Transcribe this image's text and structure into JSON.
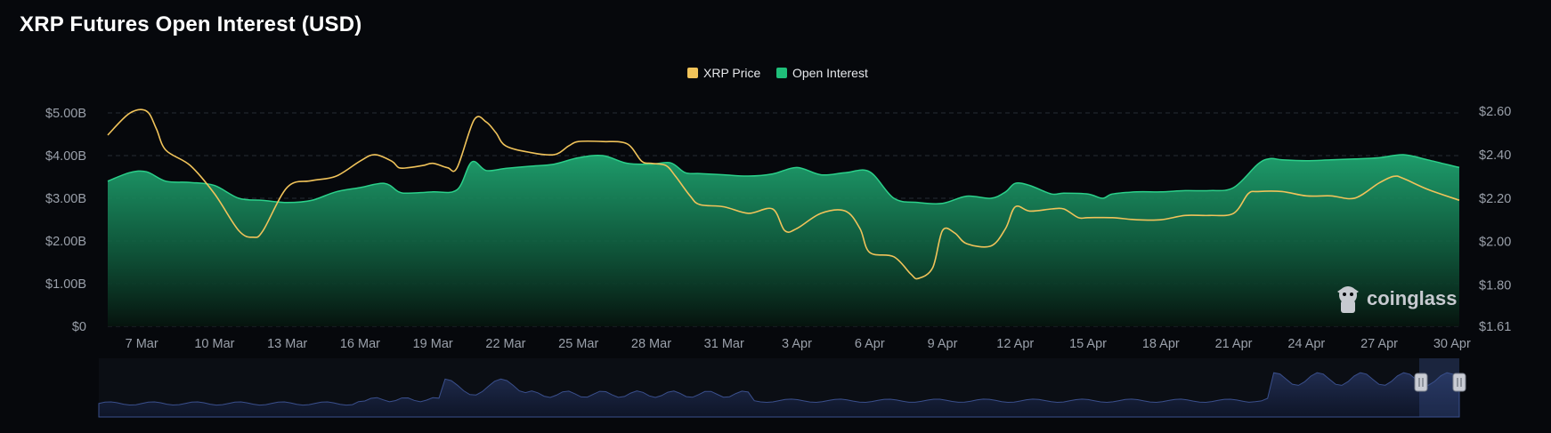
{
  "title": "XRP Futures Open Interest (USD)",
  "watermark": "coinglass",
  "legend": [
    {
      "label": "XRP Price",
      "color": "#f0c35a"
    },
    {
      "label": "Open Interest",
      "color": "#1fbf7a"
    }
  ],
  "chart_data": {
    "type": "area",
    "title": "XRP Futures Open Interest (USD)",
    "legend_position": "top-center",
    "x_tick_labels": [
      "7 Mar",
      "10 Mar",
      "13 Mar",
      "16 Mar",
      "19 Mar",
      "22 Mar",
      "25 Mar",
      "28 Mar",
      "31 Mar",
      "3 Apr",
      "6 Apr",
      "9 Apr",
      "12 Apr",
      "15 Apr",
      "18 Apr",
      "21 Apr",
      "24 Apr",
      "27 Apr",
      "30 Apr"
    ],
    "y_left": {
      "tick_labels": [
        "$0",
        "$1.00B",
        "$2.00B",
        "$3.00B",
        "$4.00B",
        "$5.00B"
      ],
      "ticks": [
        0,
        1,
        2,
        3,
        4,
        5
      ],
      "range": [
        0,
        5.5
      ],
      "unit": "billion USD"
    },
    "y_right": {
      "tick_labels": [
        "$1.61",
        "$1.80",
        "$2.00",
        "$2.20",
        "$2.40",
        "$2.60"
      ],
      "ticks": [
        1.61,
        1.8,
        2.0,
        2.2,
        2.4,
        2.6
      ],
      "range": [
        1.61,
        2.69
      ]
    },
    "grid": true,
    "x_range": [
      5.6,
      61.3
    ],
    "series": [
      {
        "name": "Open Interest",
        "axis": "left",
        "color": "#1fbf7a",
        "points": [
          [
            5.6,
            3.4
          ],
          [
            6.5,
            3.6
          ],
          [
            7.2,
            3.62
          ],
          [
            8,
            3.4
          ],
          [
            9,
            3.37
          ],
          [
            10,
            3.3
          ],
          [
            11,
            3.0
          ],
          [
            12,
            2.95
          ],
          [
            13,
            2.9
          ],
          [
            14,
            2.95
          ],
          [
            15,
            3.15
          ],
          [
            16,
            3.25
          ],
          [
            17,
            3.35
          ],
          [
            17.6,
            3.15
          ],
          [
            18,
            3.12
          ],
          [
            19,
            3.15
          ],
          [
            20,
            3.2
          ],
          [
            20.6,
            3.85
          ],
          [
            21.2,
            3.65
          ],
          [
            22,
            3.7
          ],
          [
            23,
            3.75
          ],
          [
            24,
            3.8
          ],
          [
            25,
            3.95
          ],
          [
            26,
            4.0
          ],
          [
            27,
            3.82
          ],
          [
            28,
            3.8
          ],
          [
            28.8,
            3.83
          ],
          [
            29.4,
            3.6
          ],
          [
            30,
            3.58
          ],
          [
            31,
            3.55
          ],
          [
            32,
            3.52
          ],
          [
            33,
            3.57
          ],
          [
            34,
            3.72
          ],
          [
            35,
            3.55
          ],
          [
            36,
            3.6
          ],
          [
            37,
            3.62
          ],
          [
            38,
            3.0
          ],
          [
            39,
            2.9
          ],
          [
            40,
            2.88
          ],
          [
            41,
            3.05
          ],
          [
            42,
            3.0
          ],
          [
            42.6,
            3.15
          ],
          [
            43,
            3.35
          ],
          [
            43.6,
            3.3
          ],
          [
            44.5,
            3.1
          ],
          [
            45,
            3.12
          ],
          [
            46,
            3.1
          ],
          [
            46.6,
            3.0
          ],
          [
            47,
            3.1
          ],
          [
            48,
            3.15
          ],
          [
            49,
            3.15
          ],
          [
            50,
            3.18
          ],
          [
            51,
            3.18
          ],
          [
            52,
            3.25
          ],
          [
            53,
            3.8
          ],
          [
            53.5,
            3.93
          ],
          [
            54,
            3.9
          ],
          [
            55,
            3.88
          ],
          [
            56,
            3.9
          ],
          [
            57,
            3.92
          ],
          [
            58,
            3.95
          ],
          [
            59,
            4.02
          ],
          [
            60,
            3.9
          ],
          [
            61.3,
            3.72
          ]
        ]
      },
      {
        "name": "XRP Price",
        "axis": "right",
        "color": "#f0c35a",
        "points": [
          [
            5.6,
            2.49
          ],
          [
            6.5,
            2.59
          ],
          [
            7.2,
            2.6
          ],
          [
            7.6,
            2.52
          ],
          [
            8,
            2.42
          ],
          [
            9,
            2.35
          ],
          [
            10,
            2.22
          ],
          [
            11,
            2.05
          ],
          [
            11.6,
            2.02
          ],
          [
            12,
            2.05
          ],
          [
            13,
            2.25
          ],
          [
            14,
            2.28
          ],
          [
            15,
            2.3
          ],
          [
            16,
            2.37
          ],
          [
            16.6,
            2.4
          ],
          [
            17.3,
            2.37
          ],
          [
            17.6,
            2.34
          ],
          [
            18,
            2.34
          ],
          [
            18.6,
            2.35
          ],
          [
            19,
            2.36
          ],
          [
            19.6,
            2.34
          ],
          [
            20,
            2.34
          ],
          [
            20.7,
            2.56
          ],
          [
            21.2,
            2.55
          ],
          [
            21.6,
            2.5
          ],
          [
            22,
            2.44
          ],
          [
            23,
            2.41
          ],
          [
            24,
            2.4
          ],
          [
            24.6,
            2.44
          ],
          [
            25,
            2.46
          ],
          [
            26,
            2.46
          ],
          [
            27,
            2.45
          ],
          [
            27.6,
            2.37
          ],
          [
            28,
            2.36
          ],
          [
            28.6,
            2.35
          ],
          [
            29,
            2.3
          ],
          [
            29.6,
            2.21
          ],
          [
            30,
            2.17
          ],
          [
            31,
            2.16
          ],
          [
            32,
            2.13
          ],
          [
            33,
            2.15
          ],
          [
            33.5,
            2.05
          ],
          [
            34,
            2.06
          ],
          [
            35,
            2.13
          ],
          [
            36,
            2.14
          ],
          [
            36.6,
            2.06
          ],
          [
            37,
            1.95
          ],
          [
            38,
            1.93
          ],
          [
            38.7,
            1.85
          ],
          [
            39,
            1.83
          ],
          [
            39.6,
            1.88
          ],
          [
            40,
            2.05
          ],
          [
            40.5,
            2.04
          ],
          [
            41,
            1.99
          ],
          [
            42,
            1.98
          ],
          [
            42.6,
            2.06
          ],
          [
            43,
            2.16
          ],
          [
            43.6,
            2.14
          ],
          [
            44.5,
            2.15
          ],
          [
            45,
            2.15
          ],
          [
            45.6,
            2.11
          ],
          [
            46,
            2.11
          ],
          [
            47,
            2.11
          ],
          [
            48,
            2.1
          ],
          [
            49,
            2.1
          ],
          [
            50,
            2.12
          ],
          [
            51,
            2.12
          ],
          [
            52,
            2.13
          ],
          [
            52.6,
            2.22
          ],
          [
            53,
            2.23
          ],
          [
            54,
            2.23
          ],
          [
            55,
            2.21
          ],
          [
            56,
            2.21
          ],
          [
            57,
            2.2
          ],
          [
            58,
            2.27
          ],
          [
            58.6,
            2.3
          ],
          [
            59,
            2.29
          ],
          [
            60,
            2.24
          ],
          [
            61.3,
            2.19
          ]
        ]
      }
    ]
  }
}
